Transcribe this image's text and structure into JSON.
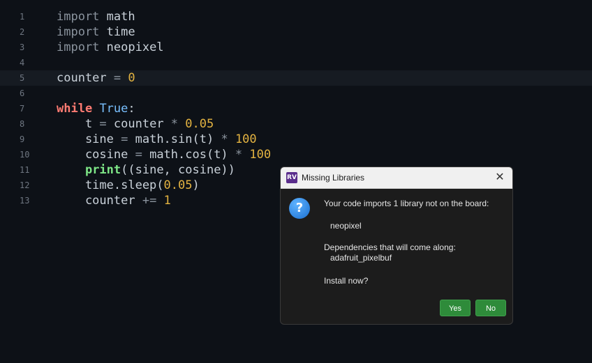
{
  "editor": {
    "lines": [
      {
        "num": "1",
        "tokens": [
          {
            "t": "import",
            "c": "kw"
          },
          {
            "t": " math",
            "c": "name"
          }
        ]
      },
      {
        "num": "2",
        "tokens": [
          {
            "t": "import",
            "c": "kw"
          },
          {
            "t": " time",
            "c": "name"
          }
        ]
      },
      {
        "num": "3",
        "tokens": [
          {
            "t": "import",
            "c": "kw"
          },
          {
            "t": " neopixel",
            "c": "name"
          }
        ]
      },
      {
        "num": "4",
        "tokens": []
      },
      {
        "num": "5",
        "tokens": [
          {
            "t": "counter ",
            "c": "name"
          },
          {
            "t": "=",
            "c": "op"
          },
          {
            "t": " ",
            "c": "name"
          },
          {
            "t": "0",
            "c": "num"
          }
        ],
        "current": true
      },
      {
        "num": "6",
        "tokens": []
      },
      {
        "num": "7",
        "tokens": [
          {
            "t": "while",
            "c": "kw2"
          },
          {
            "t": " ",
            "c": "name"
          },
          {
            "t": "True",
            "c": "true"
          },
          {
            "t": ":",
            "c": "name"
          }
        ]
      },
      {
        "num": "8",
        "tokens": [
          {
            "t": "    t ",
            "c": "name"
          },
          {
            "t": "=",
            "c": "op"
          },
          {
            "t": " counter ",
            "c": "name"
          },
          {
            "t": "*",
            "c": "op"
          },
          {
            "t": " ",
            "c": "name"
          },
          {
            "t": "0.05",
            "c": "num"
          }
        ]
      },
      {
        "num": "9",
        "tokens": [
          {
            "t": "    sine ",
            "c": "name"
          },
          {
            "t": "=",
            "c": "op"
          },
          {
            "t": " math.sin(t) ",
            "c": "name"
          },
          {
            "t": "*",
            "c": "op"
          },
          {
            "t": " ",
            "c": "name"
          },
          {
            "t": "100",
            "c": "num"
          }
        ]
      },
      {
        "num": "10",
        "tokens": [
          {
            "t": "    cosine ",
            "c": "name"
          },
          {
            "t": "=",
            "c": "op"
          },
          {
            "t": " math.cos(t) ",
            "c": "name"
          },
          {
            "t": "*",
            "c": "op"
          },
          {
            "t": " ",
            "c": "name"
          },
          {
            "t": "100",
            "c": "num"
          }
        ]
      },
      {
        "num": "11",
        "tokens": [
          {
            "t": "    ",
            "c": "name"
          },
          {
            "t": "print",
            "c": "builtin"
          },
          {
            "t": "((sine, cosine))",
            "c": "name"
          }
        ]
      },
      {
        "num": "12",
        "tokens": [
          {
            "t": "    time.sleep(",
            "c": "name"
          },
          {
            "t": "0.05",
            "c": "num"
          },
          {
            "t": ")",
            "c": "name"
          }
        ]
      },
      {
        "num": "13",
        "tokens": [
          {
            "t": "    counter ",
            "c": "name"
          },
          {
            "t": "+=",
            "c": "op"
          },
          {
            "t": " ",
            "c": "name"
          },
          {
            "t": "1",
            "c": "num"
          }
        ]
      }
    ]
  },
  "dialog": {
    "app_icon_text": "RV",
    "title": "Missing Libraries",
    "close_glyph": "✕",
    "icon_glyph": "?",
    "line1": "Your code imports 1 library not on the board:",
    "library": "neopixel",
    "deps_label": "Dependencies that will come along:",
    "dependency": "adafruit_pixelbuf",
    "question": "Install now?",
    "yes_label": "Yes",
    "no_label": "No"
  },
  "colors": {
    "background": "#0d1117",
    "accent_green": "#2e8b3a",
    "info_blue": "#1a6fd1"
  }
}
